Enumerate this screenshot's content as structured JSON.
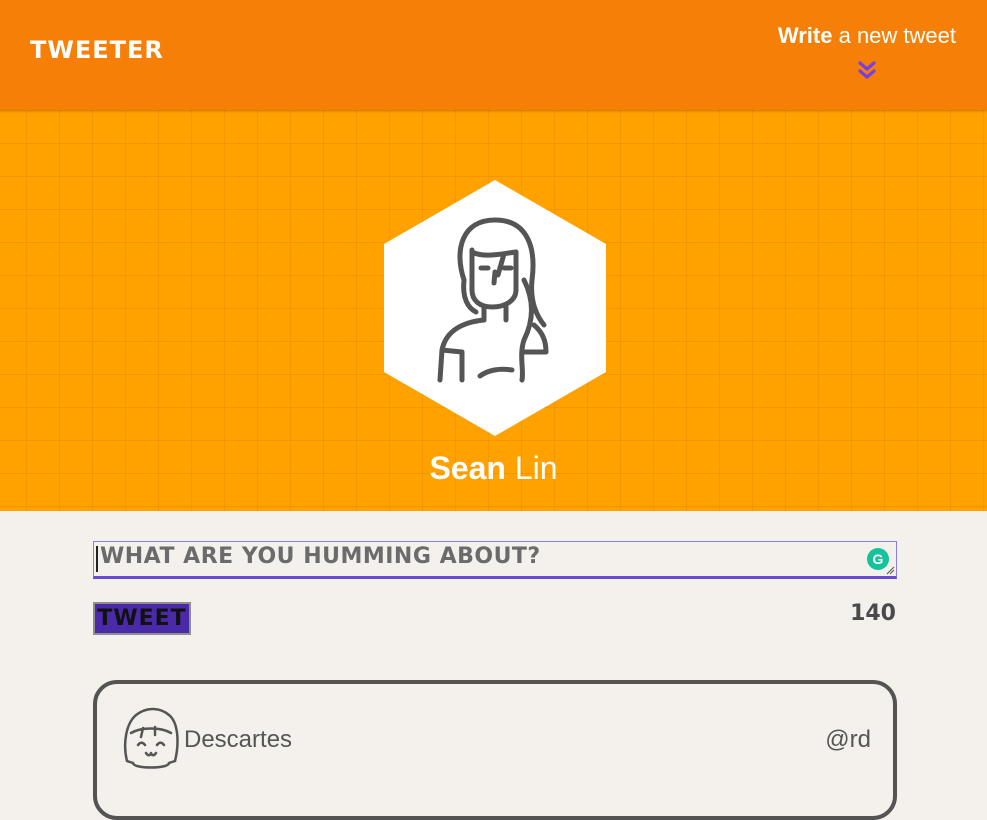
{
  "navbar": {
    "brand": "TWEETER",
    "compose_bold": "Write",
    "compose_rest": " a new tweet"
  },
  "profile": {
    "first_name": "Sean",
    "last_name": "Lin"
  },
  "composer": {
    "placeholder": "WHAT ARE YOU HUMMING ABOUT?",
    "tweet_button": "TWEET",
    "counter": "140"
  },
  "tweets": [
    {
      "author": "Descartes",
      "handle": "@rd"
    }
  ],
  "colors": {
    "navbar": "#f57f07",
    "profile_bg": "#ffa200",
    "tweet_button": "#4a2aa8",
    "page_bg": "#f4f1ec",
    "chevron": "#7a3ee6",
    "grammarly": "#15c39a"
  },
  "icons": {
    "compose_toggle": "double-chevron-down-icon",
    "grammarly": "grammarly-icon",
    "profile_avatar": "woman-avatar-icon",
    "tweet_avatar": "girl-face-avatar-icon"
  }
}
